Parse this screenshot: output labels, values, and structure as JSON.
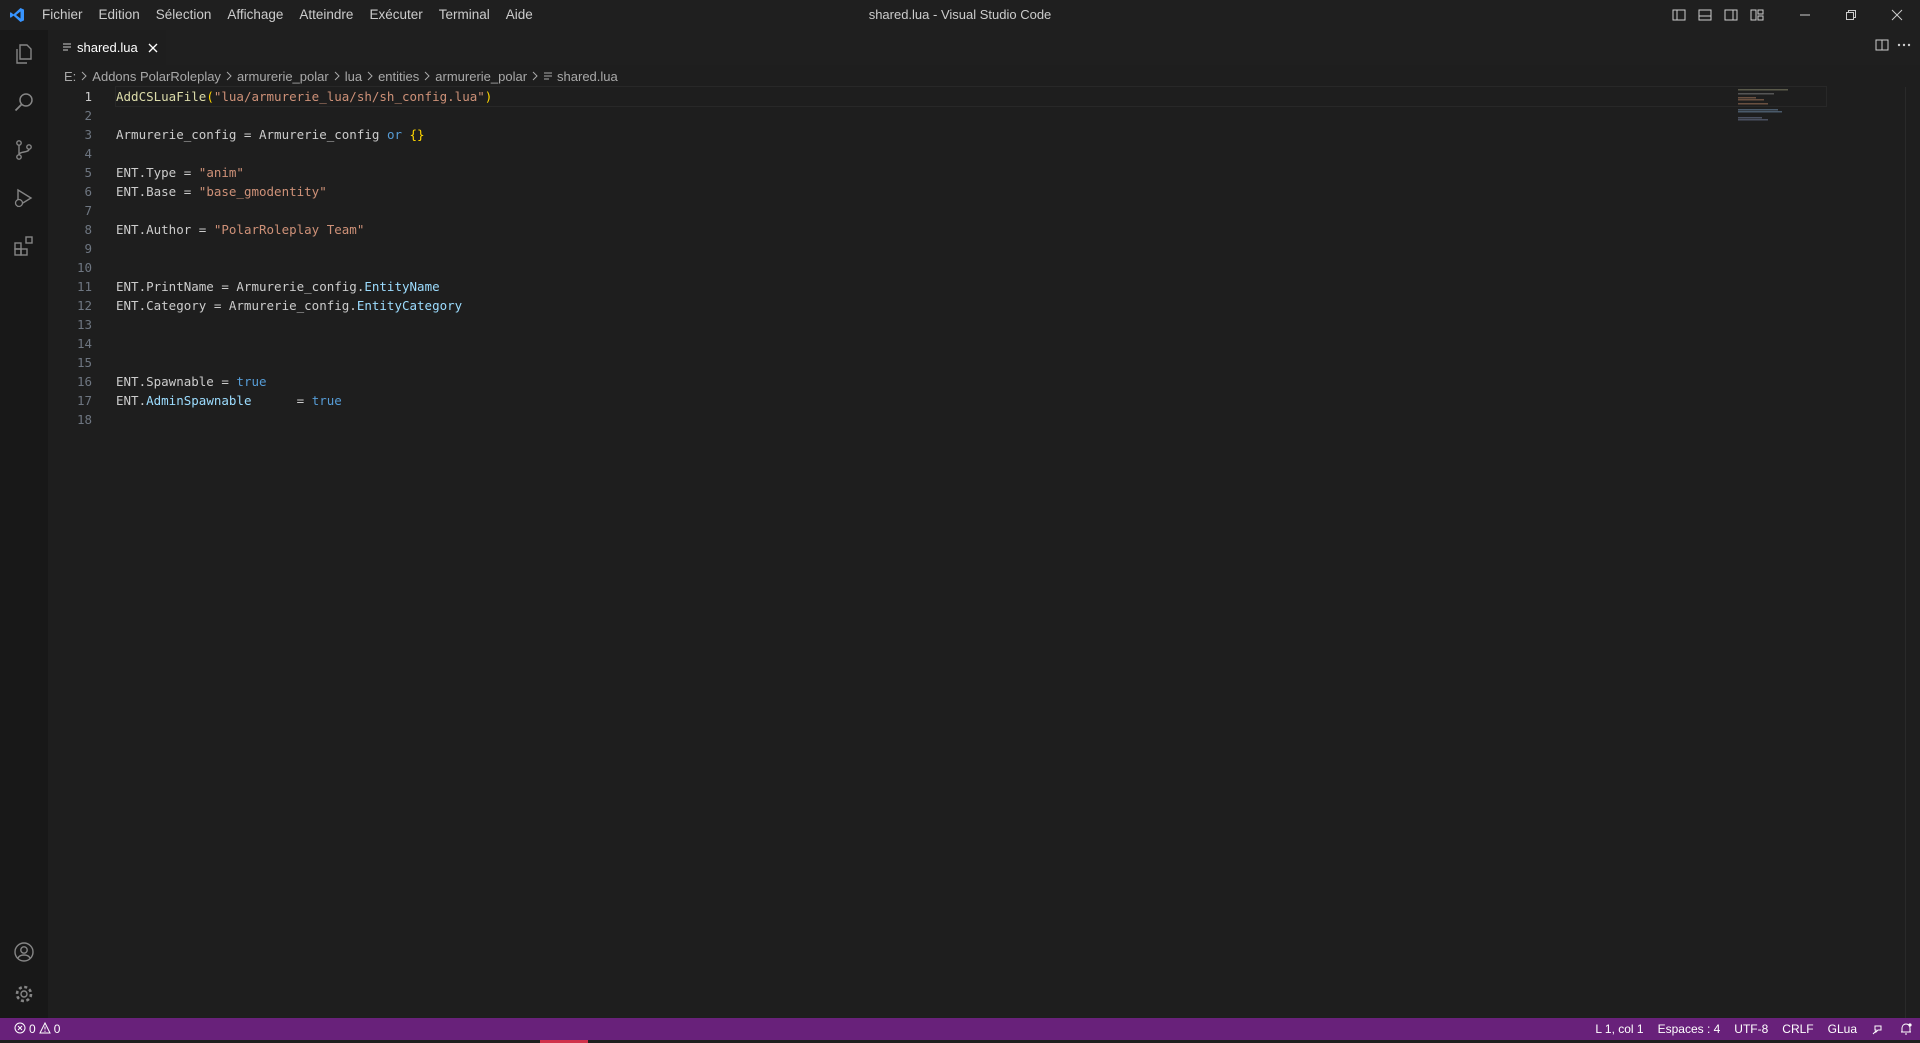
{
  "menu": [
    "Fichier",
    "Edition",
    "Sélection",
    "Affichage",
    "Atteindre",
    "Exécuter",
    "Terminal",
    "Aide"
  ],
  "window_title": "shared.lua - Visual Studio Code",
  "tab": {
    "label": "shared.lua"
  },
  "breadcrumb": {
    "items": [
      "E:",
      "Addons PolarRoleplay",
      "armurerie_polar",
      "lua",
      "entities",
      "armurerie_polar"
    ],
    "file": "shared.lua"
  },
  "editor": {
    "line_numbers": [
      "1",
      "2",
      "3",
      "4",
      "5",
      "6",
      "7",
      "8",
      "9",
      "10",
      "11",
      "12",
      "13",
      "14",
      "15",
      "16",
      "17",
      "18"
    ],
    "lines": [
      [
        {
          "t": "AddCSLuaFile",
          "c": "fn"
        },
        {
          "t": "(",
          "c": "brace"
        },
        {
          "t": "\"lua/armurerie_lua/sh/sh_config.lua\"",
          "c": "str"
        },
        {
          "t": ")",
          "c": "brace"
        }
      ],
      [],
      [
        {
          "t": "Armurerie_config = Armurerie_config ",
          "c": "id"
        },
        {
          "t": "or",
          "c": "kw"
        },
        {
          "t": " ",
          "c": "id"
        },
        {
          "t": "{}",
          "c": "brace"
        }
      ],
      [],
      [
        {
          "t": "ENT.Type = ",
          "c": "id"
        },
        {
          "t": "\"anim\"",
          "c": "str"
        }
      ],
      [
        {
          "t": "ENT.Base = ",
          "c": "id"
        },
        {
          "t": "\"base_gmodentity\"",
          "c": "str"
        }
      ],
      [],
      [
        {
          "t": "ENT.Author = ",
          "c": "id"
        },
        {
          "t": "\"PolarRoleplay Team\"",
          "c": "str"
        }
      ],
      [],
      [],
      [
        {
          "t": "ENT.PrintName = Armurerie_config.",
          "c": "id"
        },
        {
          "t": "EntityName",
          "c": "prop"
        }
      ],
      [
        {
          "t": "ENT.Category = Armurerie_config.",
          "c": "id"
        },
        {
          "t": "EntityCategory",
          "c": "prop"
        }
      ],
      [],
      [],
      [],
      [
        {
          "t": "ENT.Spawnable = ",
          "c": "id"
        },
        {
          "t": "true",
          "c": "kw"
        }
      ],
      [
        {
          "t": "ENT.",
          "c": "id"
        },
        {
          "t": "AdminSpawnable",
          "c": "prop"
        },
        {
          "t": "      = ",
          "c": "id"
        },
        {
          "t": "true",
          "c": "kw"
        }
      ],
      []
    ]
  },
  "status": {
    "errors": "0",
    "warnings": "0",
    "position": "L 1, col 1",
    "indent": "Espaces : 4",
    "encoding": "UTF-8",
    "eol": "CRLF",
    "language": "GLua"
  },
  "colors": {
    "statusbar": "#68217a",
    "accent": "#3794ff"
  }
}
